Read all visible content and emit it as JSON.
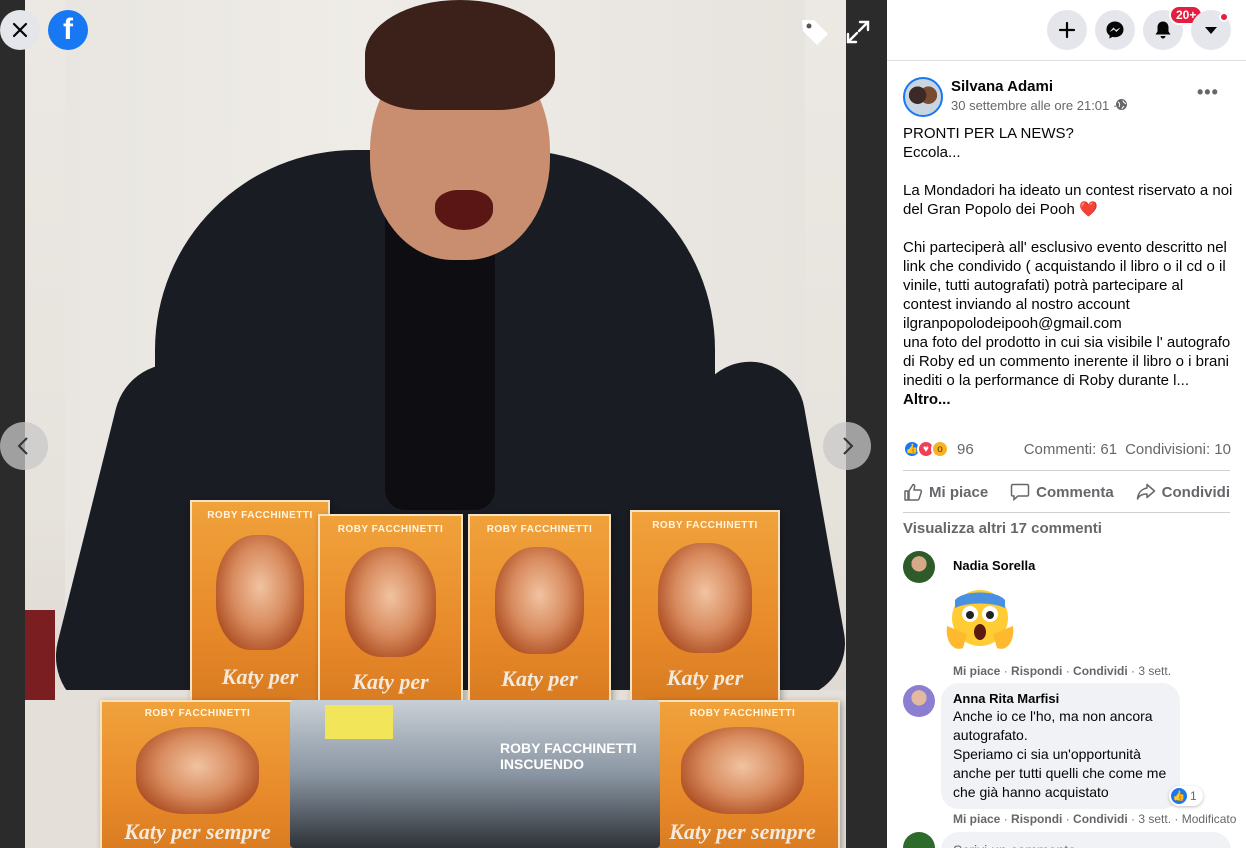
{
  "viewer": {
    "book_author": "ROBY FACCHINETTI",
    "book_title": "Katy per sempre",
    "book_title_partial": "Katy per",
    "record_text": "ROBY FACCHINETTI INSCUENDO",
    "sticker_text": "",
    "logo_letter": "f"
  },
  "topbar": {
    "notifications_badge": "20+"
  },
  "post": {
    "author": "Silvana Adami",
    "time": "30 settembre alle ore 21:01 ·",
    "more": "•••",
    "text": "PRONTI PER LA NEWS?\nEccola...\n\nLa Mondadori ha ideato un contest riservato a noi del Gran Popolo dei Pooh ",
    "heart": "❤️",
    "text2": "\n\nChi parteciperà all' esclusivo evento descritto nel link che condivido ( acquistando il libro o il cd o il vinile, tutti autografati) potrà partecipare al contest inviando al nostro account ilgranpopolodeipooh@gmail.com\nuna foto del prodotto in cui sia visibile l' autografo di Roby ed un commento inerente il libro o i brani inediti o la performance di Roby durante l... ",
    "see_more": "Altro...",
    "reaction_count": "96",
    "comments": "Commenti: 61",
    "shares": "Condivisioni: 10"
  },
  "actions": {
    "like": "Mi piace",
    "comment": "Commenta",
    "share": "Condividi"
  },
  "comments": {
    "view_more": "Visualizza altri 17 commenti",
    "c1": {
      "name": "Nadia Sorella",
      "meta_like": "Mi piace",
      "meta_reply": "Rispondi",
      "meta_share": "Condividi",
      "meta_time": "3 sett."
    },
    "c2": {
      "name": "Anna Rita Marfisi",
      "text": "Anche io ce l'ho, ma non ancora autografato.\nSperiamo ci sia un'opportunità anche per tutti quelli che come me che già hanno acquistato",
      "likes": "1",
      "meta_like": "Mi piace",
      "meta_reply": "Rispondi",
      "meta_share": "Condividi",
      "meta_time": "3 sett.",
      "meta_edited": "Modificato"
    },
    "write_placeholder": "Scrivi un commento..."
  },
  "colors": {
    "fb_blue": "#1877f2",
    "notification_red": "#e41e3f",
    "text_secondary": "#65676b"
  },
  "icons": [
    "close-icon",
    "facebook-logo",
    "tag-icon",
    "expand-icon",
    "chevron-left-icon",
    "chevron-right-icon",
    "plus-icon",
    "messenger-icon",
    "bell-icon",
    "caret-down-icon",
    "globe-icon",
    "like-icon",
    "comment-icon",
    "share-icon"
  ]
}
